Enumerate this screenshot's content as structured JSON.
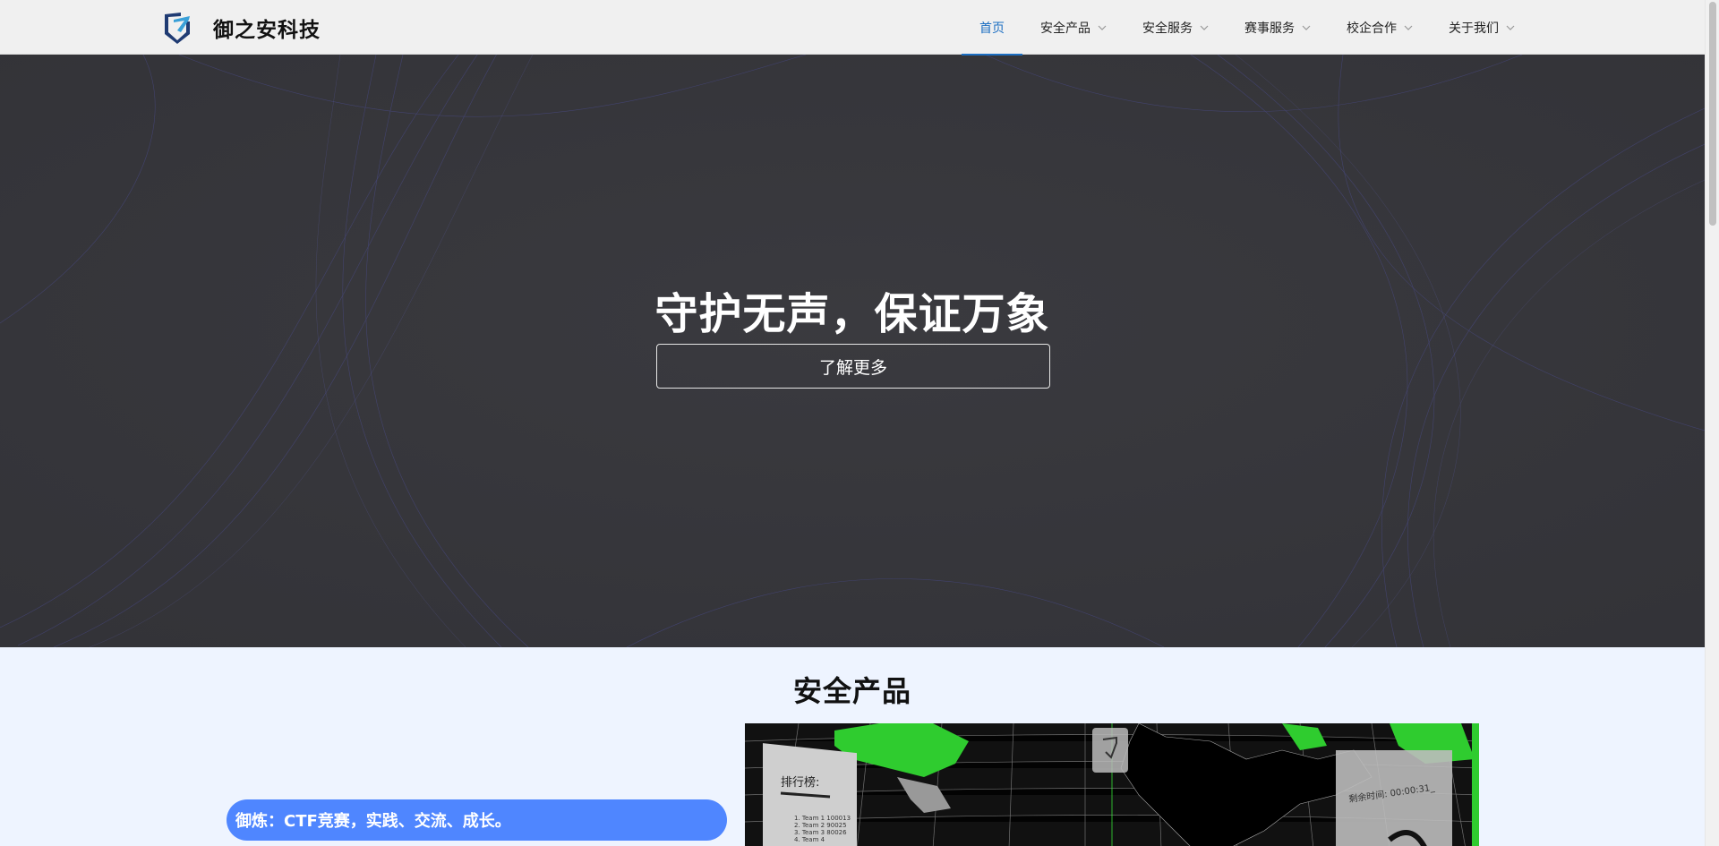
{
  "brand": {
    "name": "御之安科技",
    "logo_icon": "shield-logo-icon"
  },
  "nav": {
    "items": [
      {
        "label": "首页",
        "active": true,
        "has_dropdown": false
      },
      {
        "label": "安全产品",
        "active": false,
        "has_dropdown": true
      },
      {
        "label": "安全服务",
        "active": false,
        "has_dropdown": true
      },
      {
        "label": "赛事服务",
        "active": false,
        "has_dropdown": true
      },
      {
        "label": "校企合作",
        "active": false,
        "has_dropdown": true
      },
      {
        "label": "关于我们",
        "active": false,
        "has_dropdown": true
      }
    ]
  },
  "hero": {
    "title": "守护无声，保证万象",
    "button_label": "了解更多"
  },
  "products": {
    "section_title": "安全产品",
    "item_title": "御炼：CTF竞赛，实践、交流、成长。",
    "preview": {
      "leaderboard_title": "排行榜:",
      "leaderboard_rows": [
        "1. Team 1 100013",
        "2. Team 2 90025",
        "3. Team 3 80026",
        "4. Team 4"
      ],
      "timer": "剩余时间: 00:00:31_"
    }
  },
  "colors": {
    "accent": "#1d6fc2",
    "hero_bg": "#353539",
    "pill": "#4f86ff",
    "page_bg": "#eef4ff",
    "map_land": "#2fcc2f"
  }
}
